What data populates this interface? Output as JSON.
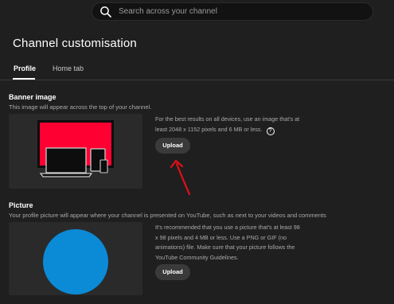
{
  "search": {
    "placeholder": "Search across your channel"
  },
  "page": {
    "title": "Channel customisation"
  },
  "tabs": [
    {
      "label": "Profile",
      "active": true
    },
    {
      "label": "Home tab",
      "active": false
    }
  ],
  "banner": {
    "title": "Banner image",
    "description": "This image will appear across the top of your channel.",
    "hint_lines": [
      "For the best results on all devices, use an image that's at",
      "least 2048 x 1152 pixels and 6 MB or less."
    ],
    "help_icon": "?",
    "upload_label": "Upload"
  },
  "picture": {
    "title": "Picture",
    "description": "Your profile picture will appear where your channel is presented on YouTube, such as next to your videos and comments",
    "hint_lines": [
      "It's recommended that you use a picture that's at least 98",
      "x 98 pixels and 4 MB or less. Use a PNG or GIF (no",
      "animations) file. Make sure that your picture follows the",
      "YouTube Community Guidelines."
    ],
    "upload_label": "Upload"
  },
  "colors": {
    "background": "#1f1f1f",
    "banner_red": "#ff0033",
    "avatar_blue": "#0b8ad6",
    "annotation_red": "#e0101a"
  },
  "icons": {
    "search": "search-icon",
    "help": "help-circle-icon"
  }
}
